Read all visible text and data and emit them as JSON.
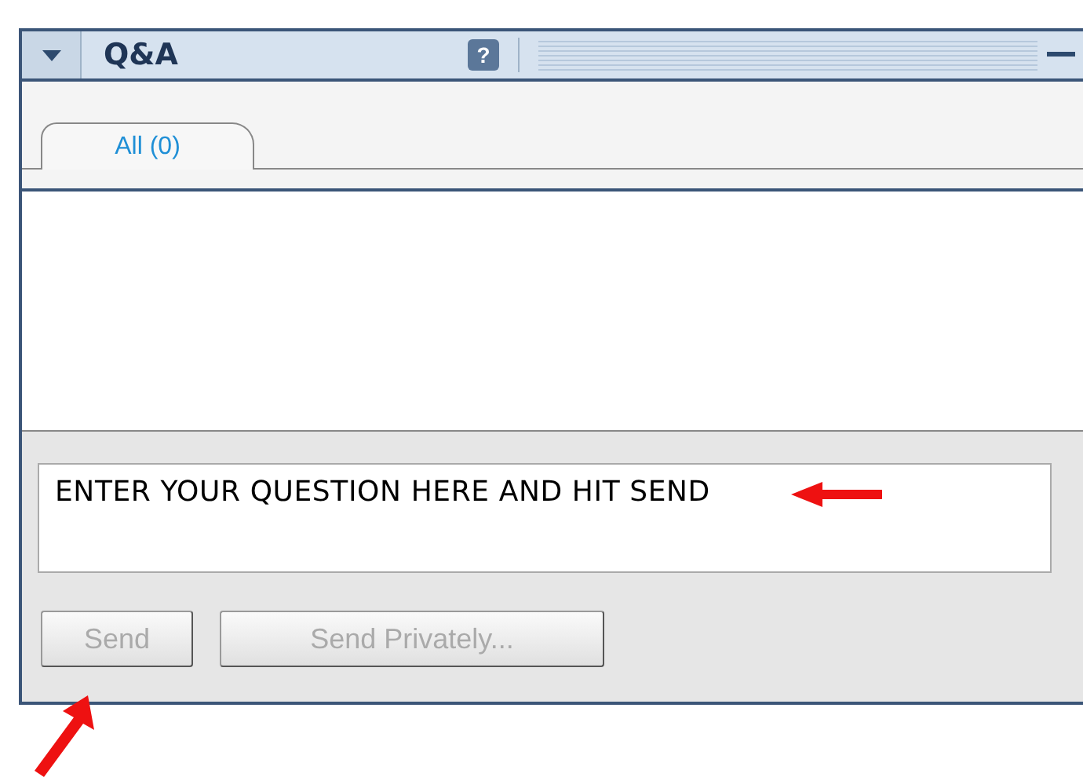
{
  "panel": {
    "title": "Q&A",
    "help": "?"
  },
  "tabs": [
    {
      "label": "All (0)",
      "selected": true
    }
  ],
  "question": {
    "value": "ENTER YOUR QUESTION HERE AND HIT SEND"
  },
  "buttons": [
    {
      "label": "Send",
      "disabled": true
    },
    {
      "label": "Send Privately...",
      "disabled": true
    }
  ]
}
